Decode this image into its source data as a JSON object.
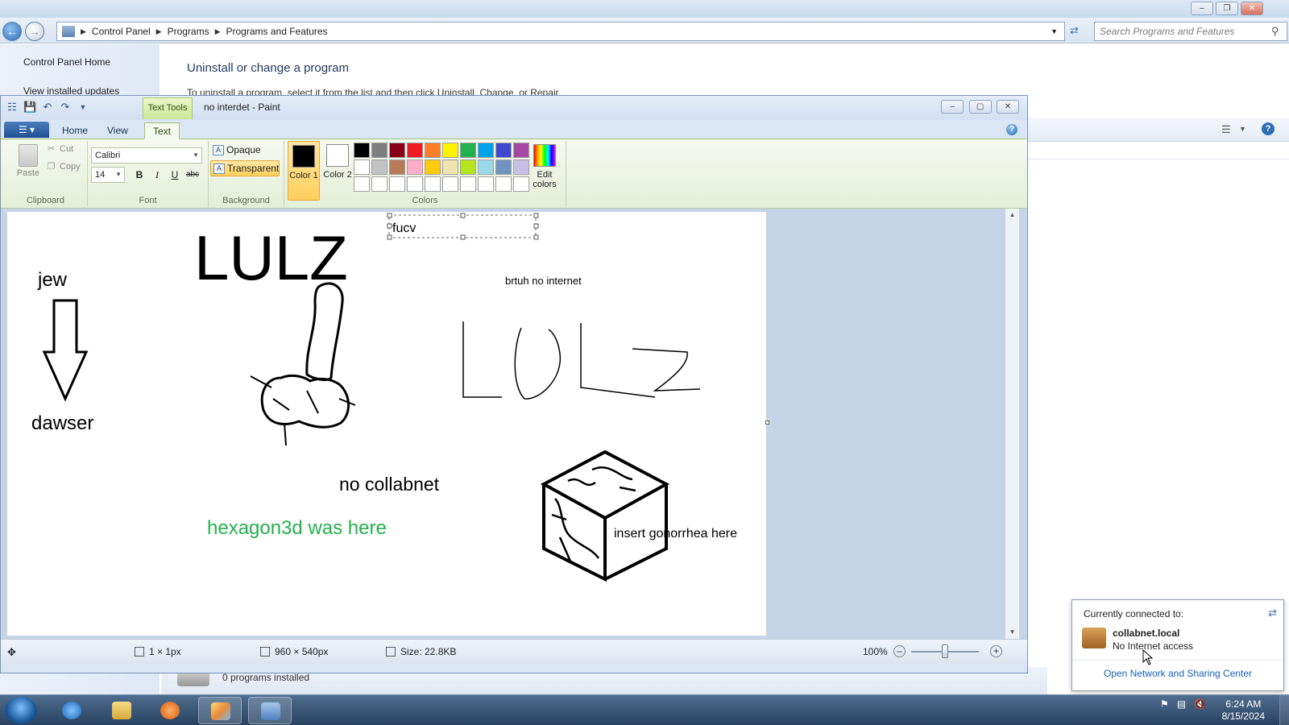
{
  "explorer": {
    "breadcrumb": [
      "Control Panel",
      "Programs",
      "Programs and Features"
    ],
    "search_placeholder": "Search Programs and Features",
    "sidebar": {
      "home": "Control Panel Home",
      "updates": "View installed updates"
    },
    "heading": "Uninstall or change a program",
    "subtext": "To uninstall a program, select it from the list and then click Uninstall, Change, or Repair.",
    "installed_count": "0 programs installed"
  },
  "paint": {
    "title": "no interdet - Paint",
    "context_tab": "Text Tools",
    "tabs": [
      "Home",
      "View",
      "Text"
    ],
    "clipboard": {
      "paste": "Paste",
      "cut": "Cut",
      "copy": "Copy",
      "label": "Clipboard"
    },
    "font": {
      "family": "Calibri",
      "size": "14",
      "label": "Font",
      "bold": "B",
      "italic": "I",
      "underline": "U",
      "strike": "abc"
    },
    "background": {
      "opaque": "Opaque",
      "transparent": "Transparent",
      "label": "Background"
    },
    "colors": {
      "label": "Colors",
      "color1_label": "Color 1",
      "color2_label": "Color 2",
      "edit_colors_label": "Edit colors",
      "color1": "#000000",
      "color2": "#ffffff",
      "palette": [
        "#000000",
        "#7f7f7f",
        "#880015",
        "#ed1c24",
        "#ff7f27",
        "#fff200",
        "#22b14c",
        "#00a2e8",
        "#3f48cc",
        "#a349a4",
        "#ffffff",
        "#c3c3c3",
        "#b97a57",
        "#ffaec9",
        "#ffc90e",
        "#efe4b0",
        "#b5e61d",
        "#99d9ea",
        "#7092be",
        "#c8bfe7",
        "#ffffff",
        "#ffffff",
        "#ffffff",
        "#ffffff",
        "#ffffff",
        "#ffffff",
        "#ffffff",
        "#ffffff",
        "#ffffff",
        "#ffffff"
      ]
    },
    "canvas_texts": {
      "lulz_big": "LULZ",
      "jew": "jew",
      "dawser": "dawser",
      "fucv": "fucv",
      "brtuh": "brtuh no internet",
      "no_collabnet": "no collabnet",
      "hexagon": "hexagon3d was here",
      "insert": "insert gonorrhea  here"
    },
    "status": {
      "cursor_size": "1 × 1px",
      "image_size": "960 × 540px",
      "file_size": "Size: 22.8KB",
      "zoom": "100%"
    }
  },
  "network_popup": {
    "header": "Currently connected to:",
    "network_name": "collabnet.local",
    "network_status": "No Internet access",
    "link": "Open Network and Sharing Center"
  },
  "taskbar": {
    "time": "6:24 AM",
    "date": "8/15/2024"
  }
}
